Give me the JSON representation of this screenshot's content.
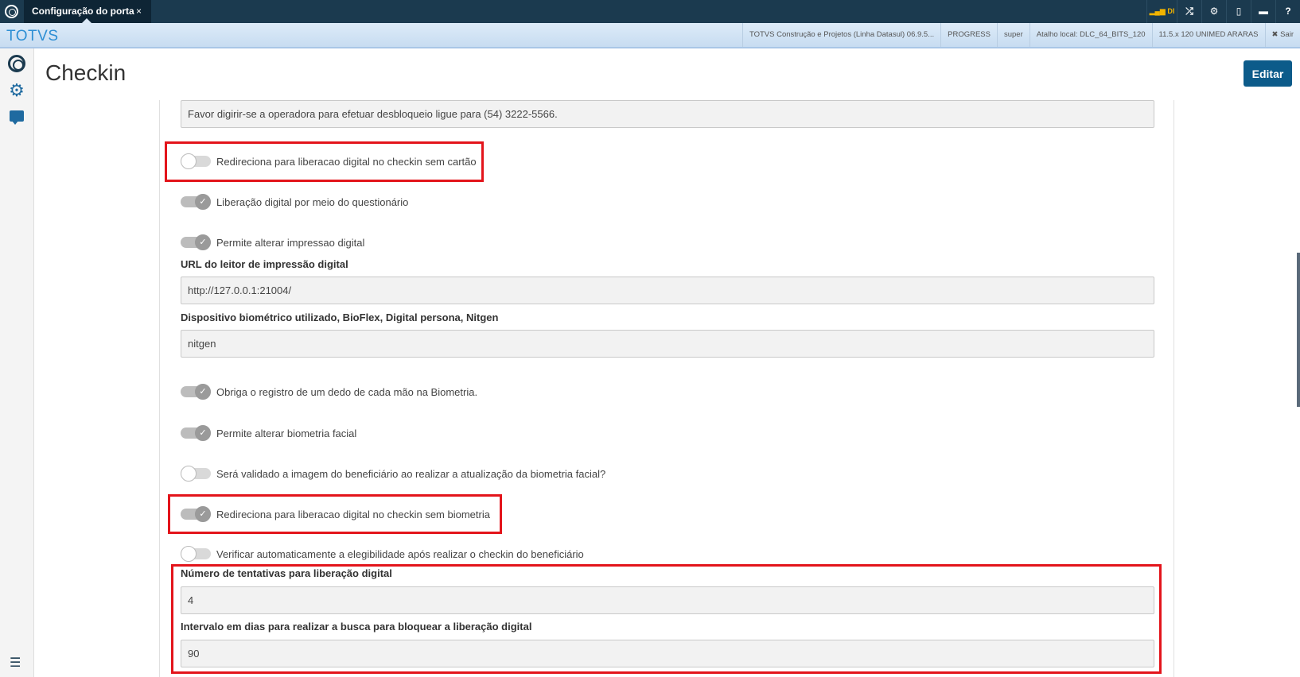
{
  "topbar": {
    "tab_title": "Configuração do porta",
    "tab_close": "×",
    "tools": [
      "signal-icon",
      "shuffle-icon",
      "gear-icon",
      "document-icon",
      "chat-icon",
      "help-icon"
    ],
    "signal_text": "DI"
  },
  "subbar": {
    "brand": "TOTVS",
    "info": [
      "TOTVS Construção e Projetos (Linha Datasul) 06.9.5...",
      "PROGRESS",
      "super",
      "Atalho local: DLC_64_BITS_120",
      "11.5.x 120 UNIMED ARARAS",
      "✖ Sair"
    ]
  },
  "page": {
    "title": "Checkin",
    "edit_label": "Editar"
  },
  "form": {
    "message_value": "Favor digirir-se a operadora para efetuar desbloqueio ligue para (54) 3222-5566.",
    "toggles": {
      "t1": "Redireciona para liberacao digital no checkin sem cartão",
      "t2": "Liberação digital por meio do questionário",
      "t3": "Permite alterar impressao digital",
      "t4": "Obriga o registro de um dedo de cada mão na Biometria.",
      "t5": "Permite alterar biometria facial",
      "t6": "Será validado a imagem do beneficiário ao realizar a atualização da biometria facial?",
      "t7": "Redireciona para liberacao digital no checkin sem biometria",
      "t8": "Verificar automaticamente a elegibilidade após realizar o checkin do beneficiário"
    },
    "url_label": "URL do leitor de impressão digital",
    "url_value": "http://127.0.0.1:21004/",
    "device_label": "Dispositivo biométrico utilizado, BioFlex, Digital persona, Nitgen",
    "device_value": "nitgen",
    "attempts_label": "Número de tentativas para liberação digital",
    "attempts_value": "4",
    "interval_label": "Intervalo em dias para realizar a busca para bloquear a liberação digital",
    "interval_value": "90"
  }
}
